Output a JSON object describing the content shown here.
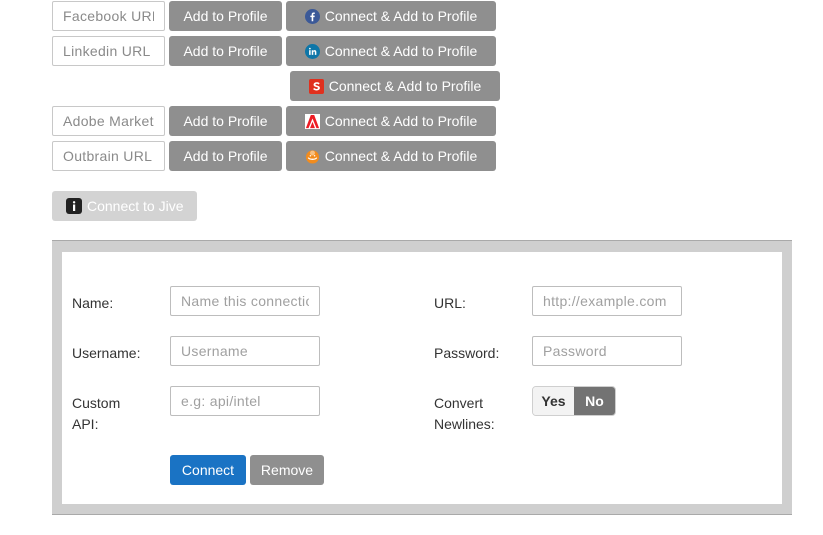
{
  "social_rows": [
    {
      "placeholder": "Facebook URL",
      "add_label": "Add to Profile",
      "connect_label": "Connect & Add to Profile",
      "icon": "facebook-icon"
    },
    {
      "placeholder": "Linkedin URL",
      "add_label": "Add to Profile",
      "connect_label": "Connect & Add to Profile",
      "icon": "linkedin-icon"
    },
    {
      "connect_label": "Connect & Add to Profile",
      "icon": "salesforce-icon"
    },
    {
      "placeholder": "Adobe Marketo URL",
      "add_label": "Add to Profile",
      "connect_label": "Connect & Add to Profile",
      "icon": "adobe-icon"
    },
    {
      "placeholder": "Outbrain URL",
      "add_label": "Add to Profile",
      "connect_label": "Connect & Add to Profile",
      "icon": "outbrain-icon"
    }
  ],
  "jive": {
    "label": "Connect to Jive",
    "icon": "jive-icon"
  },
  "form": {
    "name_label": "Name:",
    "name_placeholder": "Name this connection",
    "url_label": "URL:",
    "url_placeholder": "http://example.com",
    "username_label": "Username:",
    "username_placeholder": "Username",
    "password_label": "Password:",
    "password_placeholder": "Password",
    "custom_api_label_1": "Custom",
    "custom_api_label_2": "API:",
    "custom_api_placeholder": "e.g: api/intel",
    "convert_newlines_label_1": "Convert",
    "convert_newlines_label_2": "Newlines:",
    "toggle_yes": "Yes",
    "toggle_no": "No",
    "toggle_selected": "No",
    "connect_button": "Connect",
    "remove_button": "Remove"
  },
  "colors": {
    "primary": "#1a73c4",
    "gray_button": "#8f8f8f",
    "jive_button": "#d3d3d3",
    "facebook": "#3b5998",
    "linkedin": "#0e76a8",
    "salesforce_red": "#e0301e",
    "adobe_red": "#ed1c24",
    "outbrain_orange": "#f28c1e"
  }
}
